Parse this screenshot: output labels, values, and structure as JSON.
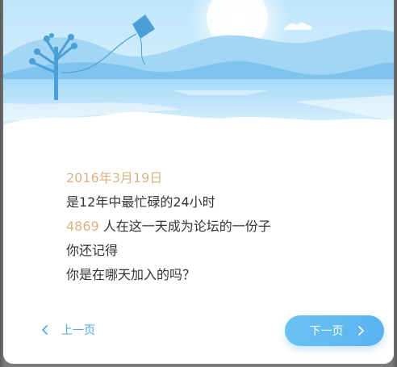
{
  "dialog": {
    "lines": {
      "date": "2016年3月19日",
      "line2": "是12年中最忙碌的24小时",
      "count": "4869",
      "line3_rest": " 人在这一天成为论坛的一份子",
      "line4": "你还记得",
      "line5": "你是在哪天加入的吗？"
    },
    "prev_label": "上一页",
    "next_label": "下一页"
  },
  "colors": {
    "accent_gold": "#d8b384",
    "primary_blue": "#5ab3f0",
    "text": "#333333"
  },
  "icons": {
    "prev": "chevron-left-icon",
    "next": "chevron-right-icon"
  }
}
